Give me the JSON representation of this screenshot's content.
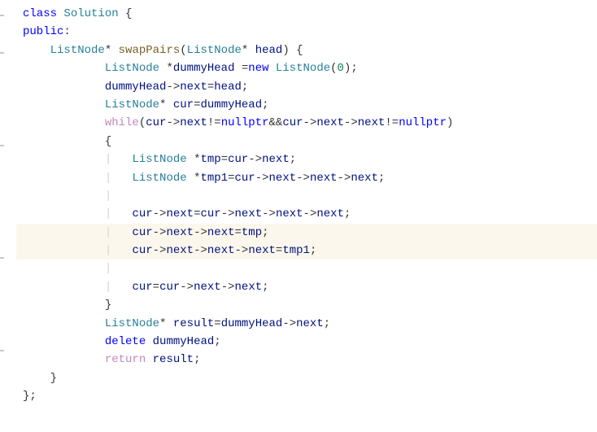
{
  "code": {
    "lines": [
      {
        "indent": 0,
        "hl": false,
        "tokens": [
          {
            "c": "kw",
            "t": "class"
          },
          {
            "c": "punct",
            "t": " "
          },
          {
            "c": "type",
            "t": "Solution"
          },
          {
            "c": "punct",
            "t": " {"
          }
        ]
      },
      {
        "indent": 0,
        "hl": false,
        "tokens": [
          {
            "c": "kw",
            "t": "public"
          },
          {
            "c": "punct",
            "t": ":"
          }
        ]
      },
      {
        "indent": 1,
        "hl": false,
        "tokens": [
          {
            "c": "type",
            "t": "ListNode"
          },
          {
            "c": "op",
            "t": "* "
          },
          {
            "c": "func",
            "t": "swapPairs"
          },
          {
            "c": "punct",
            "t": "("
          },
          {
            "c": "type",
            "t": "ListNode"
          },
          {
            "c": "op",
            "t": "* "
          },
          {
            "c": "ident",
            "t": "head"
          },
          {
            "c": "punct",
            "t": ") {"
          }
        ]
      },
      {
        "indent": 3,
        "hl": false,
        "tokens": [
          {
            "c": "type",
            "t": "ListNode"
          },
          {
            "c": "punct",
            "t": " "
          },
          {
            "c": "op",
            "t": "*"
          },
          {
            "c": "ident",
            "t": "dummyHead"
          },
          {
            "c": "punct",
            "t": " "
          },
          {
            "c": "op",
            "t": "="
          },
          {
            "c": "kw",
            "t": "new"
          },
          {
            "c": "punct",
            "t": " "
          },
          {
            "c": "type",
            "t": "ListNode"
          },
          {
            "c": "punct",
            "t": "("
          },
          {
            "c": "num",
            "t": "0"
          },
          {
            "c": "punct",
            "t": ");"
          }
        ]
      },
      {
        "indent": 3,
        "hl": false,
        "tokens": [
          {
            "c": "ident",
            "t": "dummyHead"
          },
          {
            "c": "op",
            "t": "->"
          },
          {
            "c": "ident",
            "t": "next"
          },
          {
            "c": "op",
            "t": "="
          },
          {
            "c": "ident",
            "t": "head"
          },
          {
            "c": "punct",
            "t": ";"
          }
        ]
      },
      {
        "indent": 3,
        "hl": false,
        "tokens": [
          {
            "c": "type",
            "t": "ListNode"
          },
          {
            "c": "op",
            "t": "* "
          },
          {
            "c": "ident",
            "t": "cur"
          },
          {
            "c": "op",
            "t": "="
          },
          {
            "c": "ident",
            "t": "dummyHead"
          },
          {
            "c": "punct",
            "t": ";"
          }
        ]
      },
      {
        "indent": 3,
        "hl": false,
        "tokens": [
          {
            "c": "kw2",
            "t": "while"
          },
          {
            "c": "punct",
            "t": "("
          },
          {
            "c": "ident",
            "t": "cur"
          },
          {
            "c": "op",
            "t": "->"
          },
          {
            "c": "ident",
            "t": "next"
          },
          {
            "c": "op",
            "t": "!="
          },
          {
            "c": "kw",
            "t": "nullptr"
          },
          {
            "c": "op",
            "t": "&&"
          },
          {
            "c": "ident",
            "t": "cur"
          },
          {
            "c": "op",
            "t": "->"
          },
          {
            "c": "ident",
            "t": "next"
          },
          {
            "c": "op",
            "t": "->"
          },
          {
            "c": "ident",
            "t": "next"
          },
          {
            "c": "op",
            "t": "!="
          },
          {
            "c": "kw",
            "t": "nullptr"
          },
          {
            "c": "punct",
            "t": ")"
          }
        ]
      },
      {
        "indent": 3,
        "hl": false,
        "tokens": [
          {
            "c": "punct",
            "t": "{"
          }
        ]
      },
      {
        "indent": 4,
        "hl": false,
        "tokens": [
          {
            "c": "type",
            "t": "ListNode"
          },
          {
            "c": "punct",
            "t": " "
          },
          {
            "c": "op",
            "t": "*"
          },
          {
            "c": "ident",
            "t": "tmp"
          },
          {
            "c": "op",
            "t": "="
          },
          {
            "c": "ident",
            "t": "cur"
          },
          {
            "c": "op",
            "t": "->"
          },
          {
            "c": "ident",
            "t": "next"
          },
          {
            "c": "punct",
            "t": ";"
          }
        ]
      },
      {
        "indent": 4,
        "hl": false,
        "tokens": [
          {
            "c": "type",
            "t": "ListNode"
          },
          {
            "c": "punct",
            "t": " "
          },
          {
            "c": "op",
            "t": "*"
          },
          {
            "c": "ident",
            "t": "tmp1"
          },
          {
            "c": "op",
            "t": "="
          },
          {
            "c": "ident",
            "t": "cur"
          },
          {
            "c": "op",
            "t": "->"
          },
          {
            "c": "ident",
            "t": "next"
          },
          {
            "c": "op",
            "t": "->"
          },
          {
            "c": "ident",
            "t": "next"
          },
          {
            "c": "op",
            "t": "->"
          },
          {
            "c": "ident",
            "t": "next"
          },
          {
            "c": "punct",
            "t": ";"
          }
        ]
      },
      {
        "indent": 4,
        "hl": false,
        "tokens": []
      },
      {
        "indent": 4,
        "hl": false,
        "tokens": [
          {
            "c": "ident",
            "t": "cur"
          },
          {
            "c": "op",
            "t": "->"
          },
          {
            "c": "ident",
            "t": "next"
          },
          {
            "c": "op",
            "t": "="
          },
          {
            "c": "ident",
            "t": "cur"
          },
          {
            "c": "op",
            "t": "->"
          },
          {
            "c": "ident",
            "t": "next"
          },
          {
            "c": "op",
            "t": "->"
          },
          {
            "c": "ident",
            "t": "next"
          },
          {
            "c": "op",
            "t": "->"
          },
          {
            "c": "ident",
            "t": "next"
          },
          {
            "c": "punct",
            "t": ";"
          }
        ]
      },
      {
        "indent": 4,
        "hl": true,
        "tokens": [
          {
            "c": "ident",
            "t": "cur"
          },
          {
            "c": "op",
            "t": "->"
          },
          {
            "c": "ident",
            "t": "next"
          },
          {
            "c": "op",
            "t": "->"
          },
          {
            "c": "ident",
            "t": "next"
          },
          {
            "c": "op",
            "t": "="
          },
          {
            "c": "ident",
            "t": "tmp"
          },
          {
            "c": "punct",
            "t": ";"
          }
        ]
      },
      {
        "indent": 4,
        "hl": true,
        "tokens": [
          {
            "c": "ident",
            "t": "cur"
          },
          {
            "c": "op",
            "t": "->"
          },
          {
            "c": "ident",
            "t": "next"
          },
          {
            "c": "op",
            "t": "->"
          },
          {
            "c": "ident",
            "t": "next"
          },
          {
            "c": "op",
            "t": "->"
          },
          {
            "c": "ident",
            "t": "next"
          },
          {
            "c": "op",
            "t": "="
          },
          {
            "c": "ident",
            "t": "tmp1"
          },
          {
            "c": "punct",
            "t": ";"
          }
        ]
      },
      {
        "indent": 4,
        "hl": false,
        "tokens": []
      },
      {
        "indent": 4,
        "hl": false,
        "tokens": [
          {
            "c": "ident",
            "t": "cur"
          },
          {
            "c": "op",
            "t": "="
          },
          {
            "c": "ident",
            "t": "cur"
          },
          {
            "c": "op",
            "t": "->"
          },
          {
            "c": "ident",
            "t": "next"
          },
          {
            "c": "op",
            "t": "->"
          },
          {
            "c": "ident",
            "t": "next"
          },
          {
            "c": "punct",
            "t": ";"
          }
        ]
      },
      {
        "indent": 3,
        "hl": false,
        "tokens": [
          {
            "c": "punct",
            "t": "}"
          }
        ]
      },
      {
        "indent": 3,
        "hl": false,
        "tokens": [
          {
            "c": "type",
            "t": "ListNode"
          },
          {
            "c": "op",
            "t": "* "
          },
          {
            "c": "ident",
            "t": "result"
          },
          {
            "c": "op",
            "t": "="
          },
          {
            "c": "ident",
            "t": "dummyHead"
          },
          {
            "c": "op",
            "t": "->"
          },
          {
            "c": "ident",
            "t": "next"
          },
          {
            "c": "punct",
            "t": ";"
          }
        ]
      },
      {
        "indent": 3,
        "hl": false,
        "tokens": [
          {
            "c": "kw",
            "t": "delete"
          },
          {
            "c": "punct",
            "t": " "
          },
          {
            "c": "ident",
            "t": "dummyHead"
          },
          {
            "c": "punct",
            "t": ";"
          }
        ]
      },
      {
        "indent": 3,
        "hl": false,
        "tokens": [
          {
            "c": "kw2",
            "t": "return"
          },
          {
            "c": "punct",
            "t": " "
          },
          {
            "c": "ident",
            "t": "result"
          },
          {
            "c": "punct",
            "t": ";"
          }
        ]
      },
      {
        "indent": 1,
        "hl": false,
        "tokens": [
          {
            "c": "punct",
            "t": "}"
          }
        ]
      },
      {
        "indent": 0,
        "hl": false,
        "tokens": [
          {
            "c": "punct",
            "t": "};"
          }
        ]
      }
    ],
    "indent_unit": "    ",
    "guide_char": "|   "
  }
}
